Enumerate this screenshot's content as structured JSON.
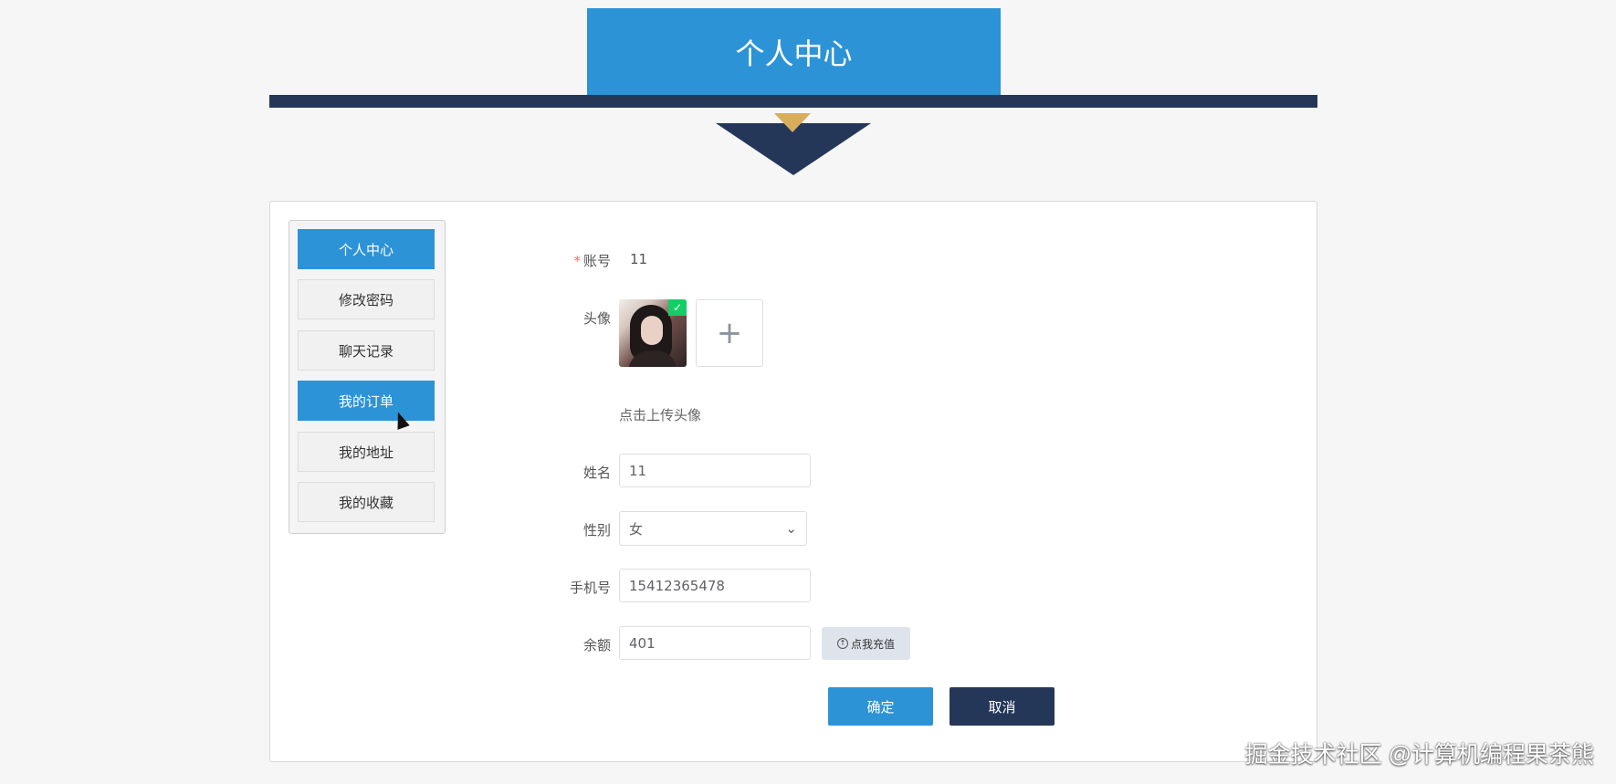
{
  "page": {
    "title": "个人中心"
  },
  "menu": {
    "items": [
      {
        "label": "个人中心"
      },
      {
        "label": "修改密码"
      },
      {
        "label": "聊天记录"
      },
      {
        "label": "我的订单"
      },
      {
        "label": "我的地址"
      },
      {
        "label": "我的收藏"
      }
    ]
  },
  "form": {
    "account": {
      "label": "账号",
      "value": "11",
      "required_mark": "*"
    },
    "avatar": {
      "label": "头像",
      "upload_tip": "点击上传头像",
      "uploaded_check": "✓",
      "add_symbol": "+"
    },
    "name": {
      "label": "姓名",
      "value": "11"
    },
    "gender": {
      "label": "性别",
      "value": "女",
      "dropdown_icon": "⌄"
    },
    "phone": {
      "label": "手机号",
      "value": "15412365478"
    },
    "balance": {
      "label": "余额",
      "value": "401",
      "recharge_icon": "↑",
      "recharge_label": "点我充值"
    }
  },
  "actions": {
    "confirm": "确定",
    "cancel": "取消"
  },
  "overlay": {
    "watermark": "掘金技术社区 @计算机编程果茶熊"
  },
  "colors": {
    "primary": "#2d93d7",
    "dark": "#253759",
    "gold": "#d9ad5c",
    "success": "#13ce66"
  },
  "icons": {
    "cursor": "hand-cursor-icon"
  }
}
